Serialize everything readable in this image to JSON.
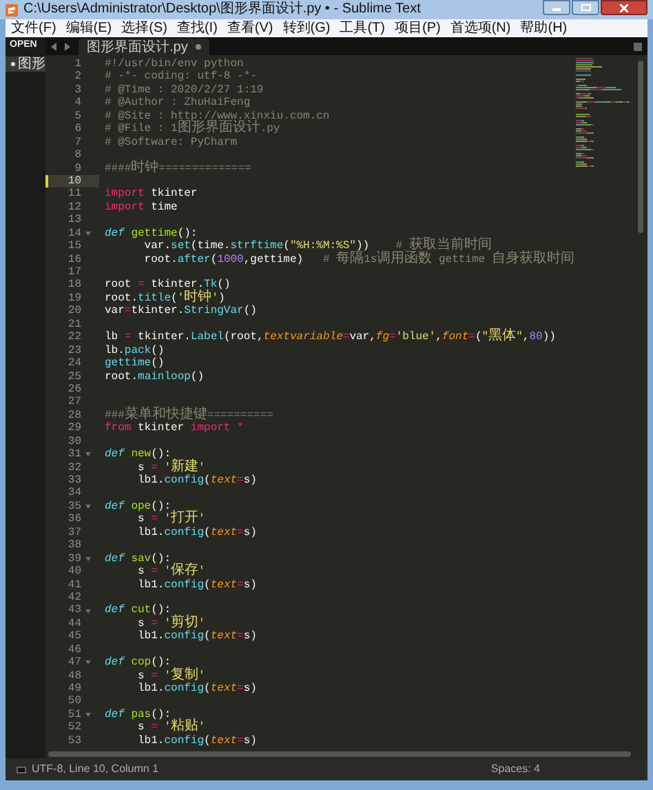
{
  "window": {
    "title": "C:\\Users\\Administrator\\Desktop\\图形界面设计.py • - Sublime Text"
  },
  "menu": [
    {
      "label": "文件(F)"
    },
    {
      "label": "编辑(E)"
    },
    {
      "label": "选择(S)"
    },
    {
      "label": "查找(I)"
    },
    {
      "label": "查看(V)"
    },
    {
      "label": "转到(G)"
    },
    {
      "label": "工具(T)"
    },
    {
      "label": "项目(P)"
    },
    {
      "label": "首选项(N)"
    },
    {
      "label": "帮助(H)"
    }
  ],
  "sidebar": {
    "header": "OPEN",
    "items": [
      {
        "label": "图形",
        "selected": true
      }
    ]
  },
  "tabs": [
    {
      "label": "图形界面设计.py",
      "selected": true
    }
  ],
  "lines": [
    {
      "number": "1",
      "fold": false,
      "current": false,
      "changed": false,
      "tokens": [
        {
          "text": "#!/usr/bin/env python",
          "kind": "comment"
        }
      ]
    },
    {
      "number": "2",
      "fold": false,
      "current": false,
      "changed": false,
      "tokens": [
        {
          "text": "# -*- coding: utf-8 -*-",
          "kind": "comment"
        }
      ]
    },
    {
      "number": "3",
      "fold": false,
      "current": false,
      "changed": false,
      "tokens": [
        {
          "text": "# @Time : 2020/2/27 1:19",
          "kind": "comment"
        }
      ]
    },
    {
      "number": "4",
      "fold": false,
      "current": false,
      "changed": false,
      "tokens": [
        {
          "text": "# @Author : ZhuHaiFeng",
          "kind": "comment"
        }
      ]
    },
    {
      "number": "5",
      "fold": false,
      "current": false,
      "changed": false,
      "tokens": [
        {
          "text": "# @Site : http://www.xinxiu.com.cn",
          "kind": "comment"
        }
      ]
    },
    {
      "number": "6",
      "fold": false,
      "current": false,
      "changed": false,
      "tokens": [
        {
          "text": "# @File : 1图形界面设计.py",
          "kind": "comment"
        }
      ]
    },
    {
      "number": "7",
      "fold": false,
      "current": false,
      "changed": false,
      "tokens": [
        {
          "text": "# @Software: PyCharm",
          "kind": "comment"
        }
      ]
    },
    {
      "number": "8",
      "fold": false,
      "current": false,
      "changed": false
    },
    {
      "number": "9",
      "fold": false,
      "current": false,
      "changed": false,
      "tokens": [
        {
          "text": "####时钟==============",
          "kind": "comment"
        }
      ]
    },
    {
      "number": "10",
      "fold": false,
      "current": true,
      "changed": true
    },
    {
      "number": "11",
      "fold": false,
      "current": false,
      "changed": false,
      "tokens": [
        {
          "text": "import",
          "kind": "keyword"
        },
        {
          "text": " tkinter",
          "kind": "plain"
        }
      ]
    },
    {
      "number": "12",
      "fold": false,
      "current": false,
      "changed": false,
      "tokens": [
        {
          "text": "import",
          "kind": "keyword"
        },
        {
          "text": " time",
          "kind": "plain"
        }
      ]
    },
    {
      "number": "13",
      "fold": false,
      "current": false,
      "changed": false
    },
    {
      "number": "14",
      "fold": true,
      "current": false,
      "changed": false,
      "tokens": [
        {
          "text": "def",
          "kind": "storage"
        },
        {
          "text": " gettime",
          "kind": "entity"
        },
        {
          "text": "():",
          "kind": "plain"
        }
      ]
    },
    {
      "number": "15",
      "fold": false,
      "current": false,
      "changed": false,
      "tokens": [
        {
          "text": "      var.",
          "kind": "plain"
        },
        {
          "text": "set",
          "kind": "support"
        },
        {
          "text": "(time.",
          "kind": "plain"
        },
        {
          "text": "strftime",
          "kind": "support"
        },
        {
          "text": "(",
          "kind": "plain"
        },
        {
          "text": "\"%H:%M:%S\"",
          "kind": "string"
        },
        {
          "text": "))    ",
          "kind": "plain"
        },
        {
          "text": "# 获取当前时间",
          "kind": "comment"
        }
      ]
    },
    {
      "number": "16",
      "fold": false,
      "current": false,
      "changed": false,
      "tokens": [
        {
          "text": "      root.",
          "kind": "plain"
        },
        {
          "text": "after",
          "kind": "support"
        },
        {
          "text": "(",
          "kind": "plain"
        },
        {
          "text": "1000",
          "kind": "number"
        },
        {
          "text": ",gettime)   ",
          "kind": "plain"
        },
        {
          "text": "# 每隔1s调用函数 gettime 自身获取时间",
          "kind": "comment"
        }
      ]
    },
    {
      "number": "17",
      "fold": false,
      "current": false,
      "changed": false
    },
    {
      "number": "18",
      "fold": false,
      "current": false,
      "changed": false,
      "tokens": [
        {
          "text": "root ",
          "kind": "plain"
        },
        {
          "text": "=",
          "kind": "operator"
        },
        {
          "text": " tkinter.",
          "kind": "plain"
        },
        {
          "text": "Tk",
          "kind": "support"
        },
        {
          "text": "()",
          "kind": "plain"
        }
      ]
    },
    {
      "number": "19",
      "fold": false,
      "current": false,
      "changed": false,
      "tokens": [
        {
          "text": "root.",
          "kind": "plain"
        },
        {
          "text": "title",
          "kind": "support"
        },
        {
          "text": "(",
          "kind": "plain"
        },
        {
          "text": "'时钟'",
          "kind": "string"
        },
        {
          "text": ")",
          "kind": "plain"
        }
      ]
    },
    {
      "number": "20",
      "fold": false,
      "current": false,
      "changed": false,
      "tokens": [
        {
          "text": "var",
          "kind": "plain"
        },
        {
          "text": "=",
          "kind": "operator"
        },
        {
          "text": "tkinter.",
          "kind": "plain"
        },
        {
          "text": "StringVar",
          "kind": "support"
        },
        {
          "text": "()",
          "kind": "plain"
        }
      ]
    },
    {
      "number": "21",
      "fold": false,
      "current": false,
      "changed": false
    },
    {
      "number": "22",
      "fold": false,
      "current": false,
      "changed": false,
      "tokens": [
        {
          "text": "lb ",
          "kind": "plain"
        },
        {
          "text": "=",
          "kind": "operator"
        },
        {
          "text": " tkinter.",
          "kind": "plain"
        },
        {
          "text": "Label",
          "kind": "support"
        },
        {
          "text": "(root,",
          "kind": "plain"
        },
        {
          "text": "textvariable",
          "kind": "param"
        },
        {
          "text": "=",
          "kind": "operator"
        },
        {
          "text": "var,",
          "kind": "plain"
        },
        {
          "text": "fg",
          "kind": "param"
        },
        {
          "text": "=",
          "kind": "operator"
        },
        {
          "text": "'blue'",
          "kind": "string"
        },
        {
          "text": ",",
          "kind": "plain"
        },
        {
          "text": "font",
          "kind": "param"
        },
        {
          "text": "=",
          "kind": "operator"
        },
        {
          "text": "(",
          "kind": "plain"
        },
        {
          "text": "\"黑体\"",
          "kind": "string"
        },
        {
          "text": ",",
          "kind": "plain"
        },
        {
          "text": "80",
          "kind": "number"
        },
        {
          "text": "))",
          "kind": "plain"
        }
      ]
    },
    {
      "number": "23",
      "fold": false,
      "current": false,
      "changed": false,
      "tokens": [
        {
          "text": "lb.",
          "kind": "plain"
        },
        {
          "text": "pack",
          "kind": "support"
        },
        {
          "text": "()",
          "kind": "plain"
        }
      ]
    },
    {
      "number": "24",
      "fold": false,
      "current": false,
      "changed": false,
      "tokens": [
        {
          "text": "gettime",
          "kind": "support"
        },
        {
          "text": "()",
          "kind": "plain"
        }
      ]
    },
    {
      "number": "25",
      "fold": false,
      "current": false,
      "changed": false,
      "tokens": [
        {
          "text": "root.",
          "kind": "plain"
        },
        {
          "text": "mainloop",
          "kind": "support"
        },
        {
          "text": "()",
          "kind": "plain"
        }
      ]
    },
    {
      "number": "26",
      "fold": false,
      "current": false,
      "changed": false
    },
    {
      "number": "27",
      "fold": false,
      "current": false,
      "changed": false
    },
    {
      "number": "28",
      "fold": false,
      "current": false,
      "changed": false,
      "tokens": [
        {
          "text": "###菜单和快捷键==========",
          "kind": "comment"
        }
      ]
    },
    {
      "number": "29",
      "fold": false,
      "current": false,
      "changed": false,
      "tokens": [
        {
          "text": "from",
          "kind": "keyword"
        },
        {
          "text": " tkinter ",
          "kind": "plain"
        },
        {
          "text": "import",
          "kind": "keyword"
        },
        {
          "text": " *",
          "kind": "operator"
        }
      ]
    },
    {
      "number": "30",
      "fold": false,
      "current": false,
      "changed": false
    },
    {
      "number": "31",
      "fold": true,
      "current": false,
      "changed": false,
      "tokens": [
        {
          "text": "def",
          "kind": "storage"
        },
        {
          "text": " new",
          "kind": "entity"
        },
        {
          "text": "():",
          "kind": "plain"
        }
      ]
    },
    {
      "number": "32",
      "fold": false,
      "current": false,
      "changed": false,
      "tokens": [
        {
          "text": "     s ",
          "kind": "plain"
        },
        {
          "text": "=",
          "kind": "operator"
        },
        {
          "text": " '新建'",
          "kind": "string"
        }
      ]
    },
    {
      "number": "33",
      "fold": false,
      "current": false,
      "changed": false,
      "tokens": [
        {
          "text": "     lb1.",
          "kind": "plain"
        },
        {
          "text": "config",
          "kind": "support"
        },
        {
          "text": "(",
          "kind": "plain"
        },
        {
          "text": "text",
          "kind": "param"
        },
        {
          "text": "=",
          "kind": "operator"
        },
        {
          "text": "s)",
          "kind": "plain"
        }
      ]
    },
    {
      "number": "34",
      "fold": false,
      "current": false,
      "changed": false
    },
    {
      "number": "35",
      "fold": true,
      "current": false,
      "changed": false,
      "tokens": [
        {
          "text": "def",
          "kind": "storage"
        },
        {
          "text": " ope",
          "kind": "entity"
        },
        {
          "text": "():",
          "kind": "plain"
        }
      ]
    },
    {
      "number": "36",
      "fold": false,
      "current": false,
      "changed": false,
      "tokens": [
        {
          "text": "     s ",
          "kind": "plain"
        },
        {
          "text": "=",
          "kind": "operator"
        },
        {
          "text": " '打开'",
          "kind": "string"
        }
      ]
    },
    {
      "number": "37",
      "fold": false,
      "current": false,
      "changed": false,
      "tokens": [
        {
          "text": "     lb1.",
          "kind": "plain"
        },
        {
          "text": "config",
          "kind": "support"
        },
        {
          "text": "(",
          "kind": "plain"
        },
        {
          "text": "text",
          "kind": "param"
        },
        {
          "text": "=",
          "kind": "operator"
        },
        {
          "text": "s)",
          "kind": "plain"
        }
      ]
    },
    {
      "number": "38",
      "fold": false,
      "current": false,
      "changed": false
    },
    {
      "number": "39",
      "fold": true,
      "current": false,
      "changed": false,
      "tokens": [
        {
          "text": "def",
          "kind": "storage"
        },
        {
          "text": " sav",
          "kind": "entity"
        },
        {
          "text": "():",
          "kind": "plain"
        }
      ]
    },
    {
      "number": "40",
      "fold": false,
      "current": false,
      "changed": false,
      "tokens": [
        {
          "text": "     s ",
          "kind": "plain"
        },
        {
          "text": "=",
          "kind": "operator"
        },
        {
          "text": " '保存'",
          "kind": "string"
        }
      ]
    },
    {
      "number": "41",
      "fold": false,
      "current": false,
      "changed": false,
      "tokens": [
        {
          "text": "     lb1.",
          "kind": "plain"
        },
        {
          "text": "config",
          "kind": "support"
        },
        {
          "text": "(",
          "kind": "plain"
        },
        {
          "text": "text",
          "kind": "param"
        },
        {
          "text": "=",
          "kind": "operator"
        },
        {
          "text": "s)",
          "kind": "plain"
        }
      ]
    },
    {
      "number": "42",
      "fold": false,
      "current": false,
      "changed": false
    },
    {
      "number": "43",
      "fold": true,
      "current": false,
      "changed": false,
      "tokens": [
        {
          "text": "def",
          "kind": "storage"
        },
        {
          "text": " cut",
          "kind": "entity"
        },
        {
          "text": "():",
          "kind": "plain"
        }
      ]
    },
    {
      "number": "44",
      "fold": false,
      "current": false,
      "changed": false,
      "tokens": [
        {
          "text": "     s ",
          "kind": "plain"
        },
        {
          "text": "=",
          "kind": "operator"
        },
        {
          "text": " '剪切'",
          "kind": "string"
        }
      ]
    },
    {
      "number": "45",
      "fold": false,
      "current": false,
      "changed": false,
      "tokens": [
        {
          "text": "     lb1.",
          "kind": "plain"
        },
        {
          "text": "config",
          "kind": "support"
        },
        {
          "text": "(",
          "kind": "plain"
        },
        {
          "text": "text",
          "kind": "param"
        },
        {
          "text": "=",
          "kind": "operator"
        },
        {
          "text": "s)",
          "kind": "plain"
        }
      ]
    },
    {
      "number": "46",
      "fold": false,
      "current": false,
      "changed": false
    },
    {
      "number": "47",
      "fold": true,
      "current": false,
      "changed": false,
      "tokens": [
        {
          "text": "def",
          "kind": "storage"
        },
        {
          "text": " cop",
          "kind": "entity"
        },
        {
          "text": "():",
          "kind": "plain"
        }
      ]
    },
    {
      "number": "48",
      "fold": false,
      "current": false,
      "changed": false,
      "tokens": [
        {
          "text": "     s ",
          "kind": "plain"
        },
        {
          "text": "=",
          "kind": "operator"
        },
        {
          "text": " '复制'",
          "kind": "string"
        }
      ]
    },
    {
      "number": "49",
      "fold": false,
      "current": false,
      "changed": false,
      "tokens": [
        {
          "text": "     lb1.",
          "kind": "plain"
        },
        {
          "text": "config",
          "kind": "support"
        },
        {
          "text": "(",
          "kind": "plain"
        },
        {
          "text": "text",
          "kind": "param"
        },
        {
          "text": "=",
          "kind": "operator"
        },
        {
          "text": "s)",
          "kind": "plain"
        }
      ]
    },
    {
      "number": "50",
      "fold": false,
      "current": false,
      "changed": false
    },
    {
      "number": "51",
      "fold": true,
      "current": false,
      "changed": false,
      "tokens": [
        {
          "text": "def",
          "kind": "storage"
        },
        {
          "text": " pas",
          "kind": "entity"
        },
        {
          "text": "():",
          "kind": "plain"
        }
      ]
    },
    {
      "number": "52",
      "fold": false,
      "current": false,
      "changed": false,
      "tokens": [
        {
          "text": "     s ",
          "kind": "plain"
        },
        {
          "text": "=",
          "kind": "operator"
        },
        {
          "text": " '粘贴'",
          "kind": "string"
        }
      ]
    },
    {
      "number": "53",
      "fold": false,
      "current": false,
      "changed": false,
      "tokens": [
        {
          "text": "     lb1.",
          "kind": "plain"
        },
        {
          "text": "config",
          "kind": "support"
        },
        {
          "text": "(",
          "kind": "plain"
        },
        {
          "text": "text",
          "kind": "param"
        },
        {
          "text": "=",
          "kind": "operator"
        },
        {
          "text": "s)",
          "kind": "plain"
        }
      ]
    }
  ],
  "status_bar": {
    "left": "UTF-8, Line 10, Column 1",
    "right": "Spaces: 4"
  }
}
